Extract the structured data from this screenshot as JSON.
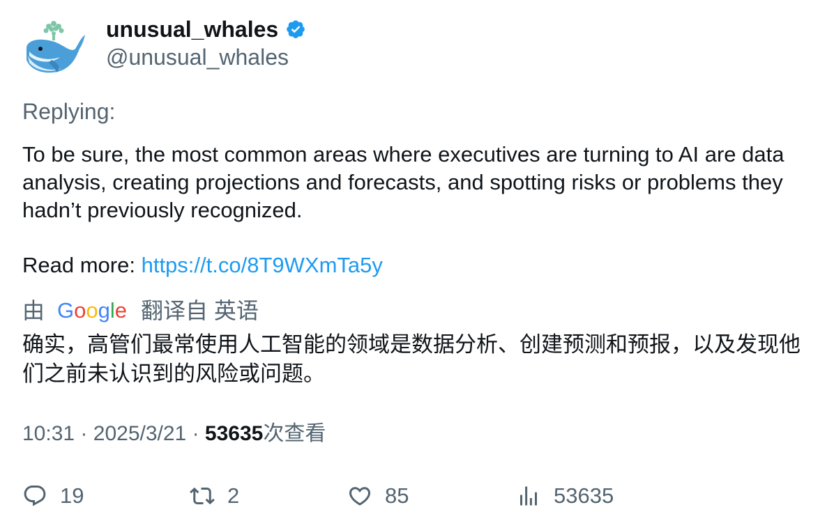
{
  "user": {
    "display_name": "unusual_whales",
    "handle": "@unusual_whales",
    "verified_icon": "verified-badge-icon",
    "avatar_icon": "whale-avatar"
  },
  "tweet": {
    "replying_label": "Replying:",
    "text": "To be sure, the most common areas where executives are turning to AI are data analysis, creating projections and forecasts, and spotting risks or problems they hadn’t previously recognized.",
    "read_more_label": "Read more:",
    "link": "https://t.co/8T9WXmTa5y"
  },
  "translation": {
    "by_label": "由",
    "provider": "Google",
    "from_label": "翻译自 英语",
    "text": "确实，高管们最常使用人工智能的领域是数据分析、创建预测和预报，以及发现他们之前未认识到的风险或问题。"
  },
  "meta": {
    "time": "10:31",
    "separator": "·",
    "date": "2025/3/21",
    "views_count": "53635",
    "views_label": "次查看"
  },
  "actions": {
    "replies": "19",
    "retweets": "2",
    "likes": "85",
    "views": "53635"
  },
  "colors": {
    "link": "#1d9bf0",
    "secondary_text": "#536471",
    "verified": "#1d9bf0"
  }
}
